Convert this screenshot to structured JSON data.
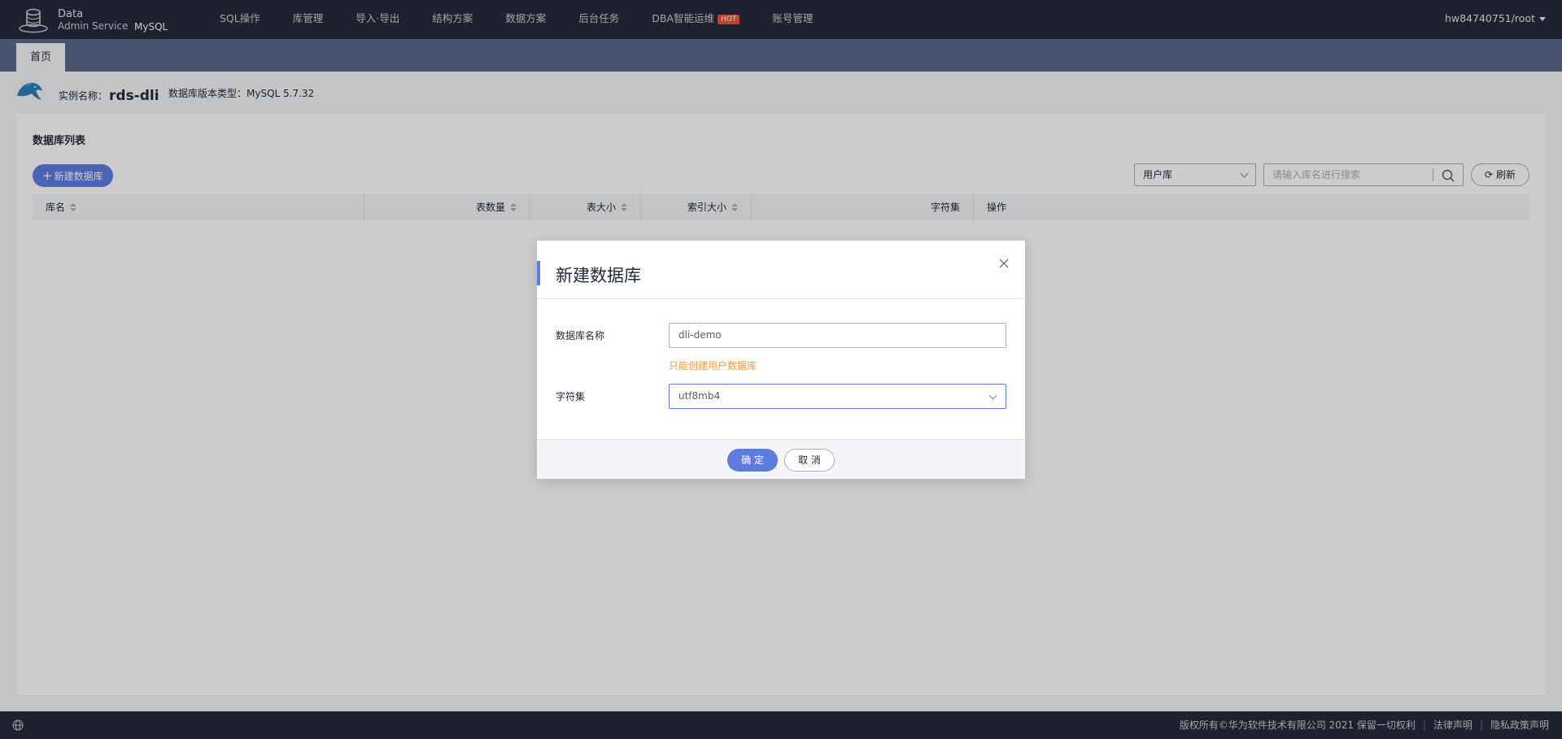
{
  "brand": {
    "line1": "Data",
    "line2": "Admin Service",
    "engine": "MySQL"
  },
  "nav": {
    "items": [
      {
        "label": "SQL操作"
      },
      {
        "label": "库管理"
      },
      {
        "label": "导入·导出"
      },
      {
        "label": "结构方案"
      },
      {
        "label": "数据方案"
      },
      {
        "label": "后台任务"
      },
      {
        "label": "DBA智能运维",
        "badge": "HOT"
      },
      {
        "label": "账号管理"
      }
    ],
    "user": "hw84740751/root"
  },
  "tabs": {
    "home": "首页"
  },
  "instance": {
    "name_label": "实例名称：",
    "name": "rds-dli",
    "version_label": "数据库版本类型：MySQL 5.7.32"
  },
  "panel": {
    "title": "数据库列表",
    "new_db_button": "新建数据库",
    "db_type_select": "用户库",
    "search_placeholder": "请输入库名进行搜索",
    "refresh_button": "刷新",
    "columns": [
      "库名",
      "表数量",
      "表大小",
      "索引大小",
      "字符集",
      "操作"
    ]
  },
  "dialog": {
    "title": "新建数据库",
    "name_label": "数据库名称",
    "name_value": "dli-demo",
    "hint": "只能创建用户数据库",
    "charset_label": "字符集",
    "charset_value": "utf8mb4",
    "ok_button": "确 定",
    "cancel_button": "取 消"
  },
  "footer": {
    "copyright": "版权所有©华为软件技术有限公司 2021 保留一切权利",
    "legal": "法律声明",
    "privacy": "隐私政策声明"
  },
  "colors": {
    "brand_blue": "#5e7ce0",
    "topbar": "#252b3a",
    "hint_orange": "#fa9841",
    "hot_badge": "#e8553f"
  }
}
